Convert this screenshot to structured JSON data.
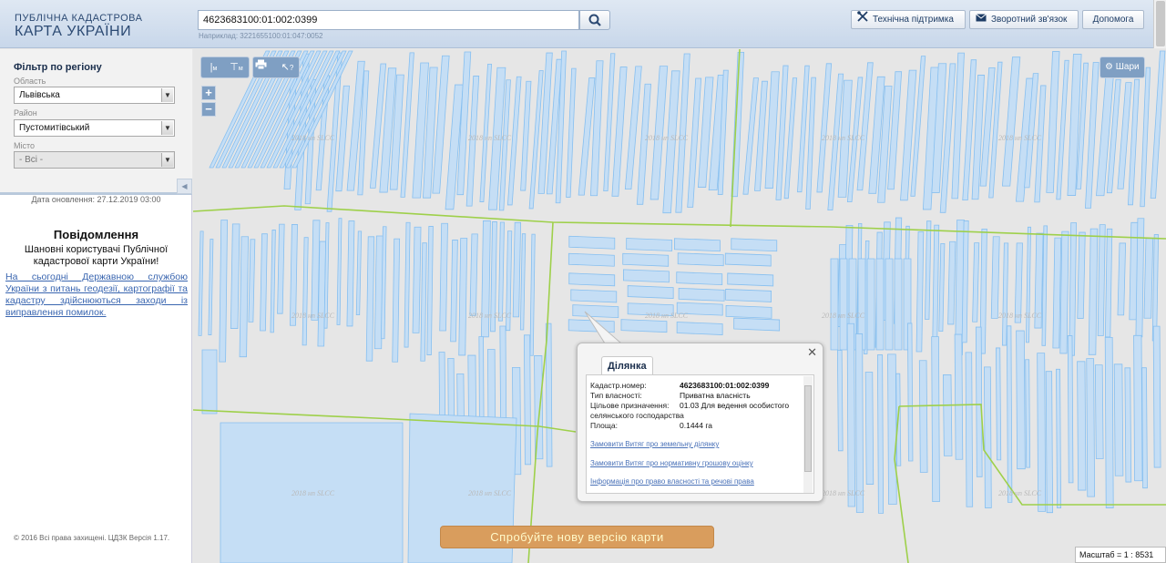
{
  "header": {
    "brand_line1": "ПУБЛІЧНА КАДАСТРОВА",
    "brand_line2": "КАРТА УКРАЇНИ",
    "search_value": "4623683100:01:002:0399",
    "search_hint": "Наприклад: 3221655100:01:047:0052",
    "buttons": {
      "tech_support": "Технічна підтримка",
      "feedback": "Зворотний зв'язок",
      "help": "Допомога"
    }
  },
  "sidebar": {
    "filter_title": "Фільтр по регіону",
    "oblast_label": "Область",
    "oblast_value": "Львівська",
    "raion_label": "Район",
    "raion_value": "Пустомитівський",
    "city_label": "Місто",
    "city_value": "- Всі -",
    "update_date": "Дата оновлення: 27.12.2019 03:00",
    "notice_title": "Повідомлення",
    "notice_text": "Шановні користувачі Публічної кадастрової карти України!",
    "notice_link": "На сьогодні Державною службою України з питань геодезії, картографії та кадастру здійснюються заходи із виправлення помилок.",
    "copyright": "© 2016 Всі права захищені. ЦДЗК Версія 1.17."
  },
  "map": {
    "layers_label": "Шари",
    "watermark": "2018 нп SLCC",
    "new_version_label": "Спробуйте нову версію карти",
    "scale_label": "Масштаб = 1 : 8531",
    "popup": {
      "tab_label": "Ділянка",
      "rows": [
        {
          "label": "Кадастр.номер:",
          "value": "4623683100:01:002:0399"
        },
        {
          "label": "Тип власності:",
          "value": "Приватна власність"
        },
        {
          "label": "Цільове призначення:",
          "value": "01.03 Для ведення особистого"
        },
        {
          "label": "селянського господарства",
          "value": ""
        },
        {
          "label": "Площа:",
          "value": "0.1444 га"
        }
      ],
      "links": [
        "Замовити Витяг про земельну ділянку",
        "Замовити Витяг про нормативну грошову оцінку",
        "Інформація про право власності та речові права"
      ]
    }
  },
  "colors": {
    "parcel_fill": "#c5def5",
    "parcel_stroke": "#86bff0",
    "boundary_line": "#9ed04a",
    "accent": "#7f9fc3"
  }
}
